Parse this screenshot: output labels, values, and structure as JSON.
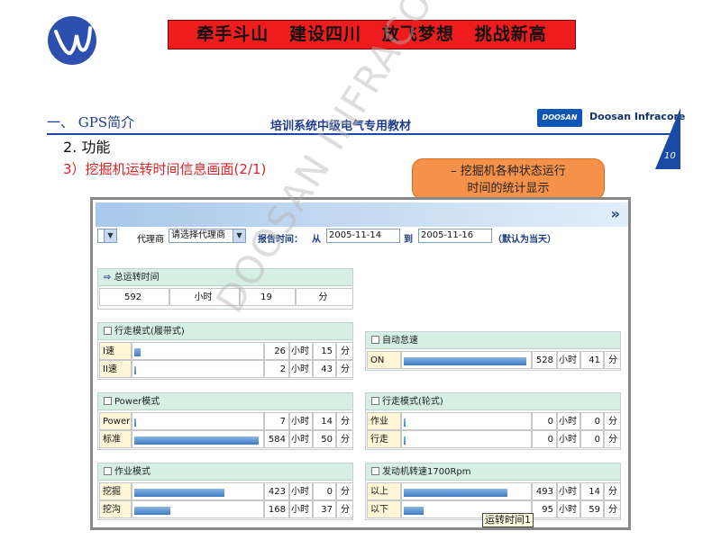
{
  "header": {
    "banner": "牵手斗山   建设四川   放飞梦想   挑战新高",
    "section": "一、 GPS简介",
    "subtitle": "培训系统中级电气专用教材",
    "brand_logo": "DOOSAN",
    "brand_name": "Doosan Infracore",
    "page_number": "10"
  },
  "content": {
    "function_heading": "2. 功能",
    "item_heading": "3）挖掘机运转时间信息画面(2/1)",
    "callout": [
      "– 挖掘机各种状态运行",
      "时间的统计显示"
    ]
  },
  "screenshot": {
    "chevron": "»",
    "filter": {
      "dealer_label": "代理商",
      "dealer_select": "请选择代理商",
      "report_time_label": "报告时间：",
      "from_label": "从",
      "from_date": "2005-11-14",
      "to_label": "到",
      "to_date": "2005-11-16",
      "default_hint": "（默认为当天）"
    },
    "total": {
      "title": "总运转时间",
      "hours": "592",
      "hours_unit": "小时",
      "minutes": "19",
      "minutes_unit": "分"
    },
    "panels": {
      "travel_crawler": {
        "title": "行走模式(履带式)",
        "rows": [
          {
            "label": "I速",
            "hours": "26",
            "minutes": "15",
            "fill": 0.05
          },
          {
            "label": "II速",
            "hours": "2",
            "minutes": "43",
            "fill": 0.01
          }
        ]
      },
      "auto_idle": {
        "title": "自动怠速",
        "rows": [
          {
            "label": "ON",
            "hours": "528",
            "minutes": "41",
            "fill": 0.99
          }
        ]
      },
      "power_mode": {
        "title": "Power模式",
        "rows": [
          {
            "label": "Power",
            "hours": "7",
            "minutes": "14",
            "fill": 0.01
          },
          {
            "label": "标准",
            "hours": "584",
            "minutes": "50",
            "fill": 0.99
          }
        ]
      },
      "travel_wheel": {
        "title": "行走模式(轮式)",
        "rows": [
          {
            "label": "作业",
            "hours": "0",
            "minutes": "0",
            "fill": 0.005
          },
          {
            "label": "行走",
            "hours": "0",
            "minutes": "0",
            "fill": 0.005
          }
        ]
      },
      "work_mode": {
        "title": "作业模式",
        "rows": [
          {
            "label": "挖掘",
            "hours": "423",
            "minutes": "0",
            "fill": 0.72
          },
          {
            "label": "挖沟",
            "hours": "168",
            "minutes": "37",
            "fill": 0.29
          }
        ]
      },
      "engine_speed": {
        "title": "发动机转速1700Rpm",
        "rows": [
          {
            "label": "以上",
            "hours": "493",
            "minutes": "14",
            "fill": 0.84
          },
          {
            "label": "以下",
            "hours": "95",
            "minutes": "59",
            "fill": 0.16
          }
        ]
      }
    },
    "units": {
      "hour": "小时",
      "minute": "分"
    },
    "tooltip": "运转时间1"
  }
}
